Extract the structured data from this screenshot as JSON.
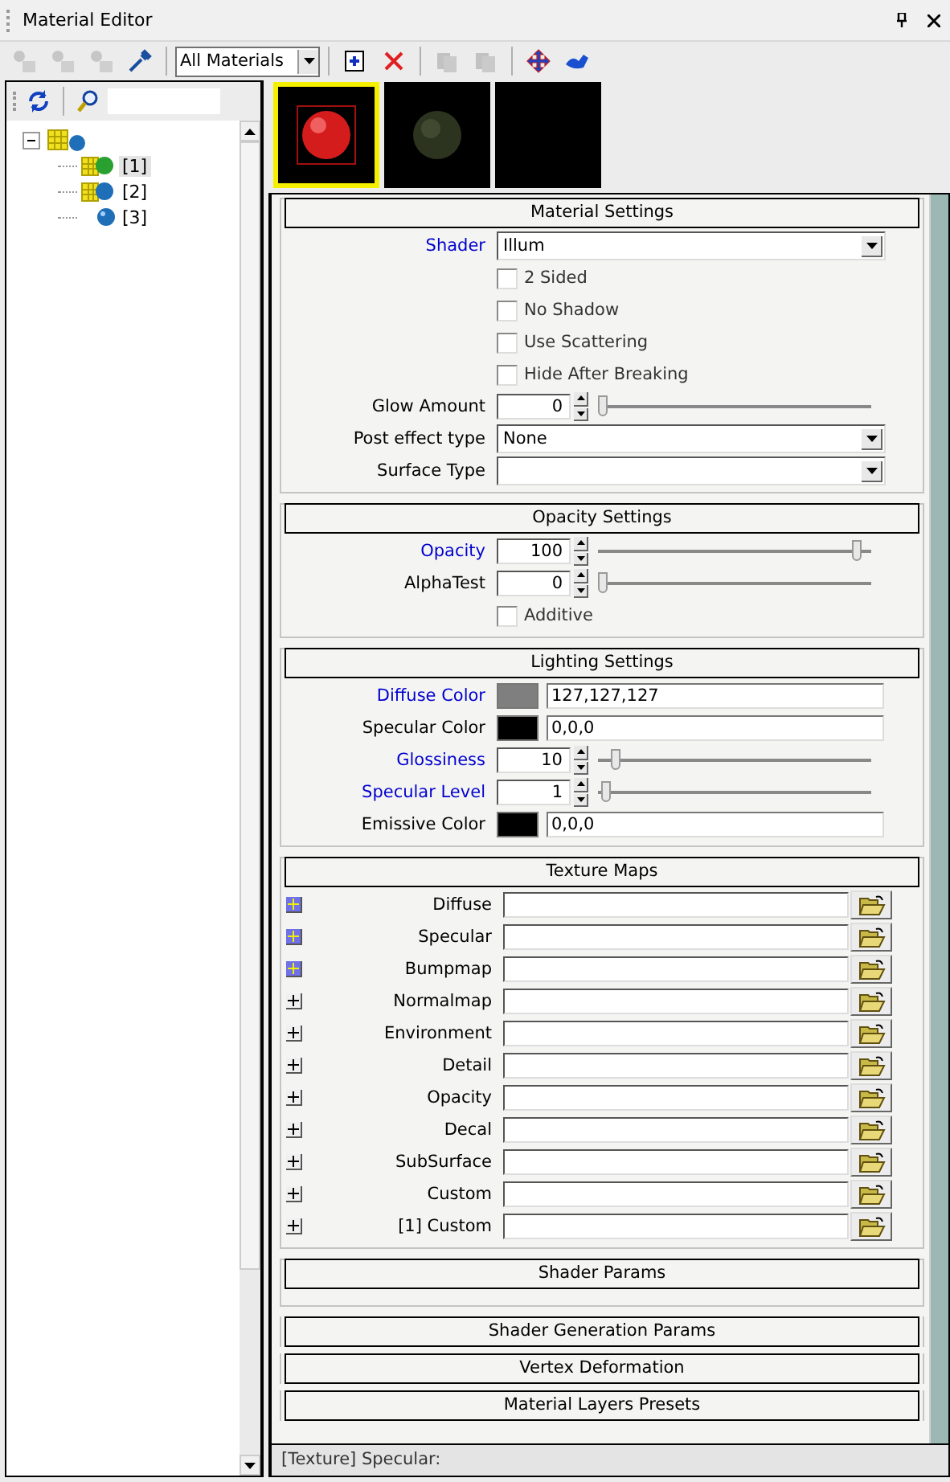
{
  "window": {
    "title": "Material Editor"
  },
  "toolbar": {
    "left_buttons": [
      {
        "kind": "get",
        "disabled": true
      },
      {
        "kind": "put",
        "disabled": true
      },
      {
        "kind": "assign",
        "disabled": true
      },
      {
        "kind": "pick",
        "disabled": false
      }
    ],
    "filter": {
      "value": "All Materials"
    },
    "right_buttons": [
      {
        "kind": "new",
        "disabled": false
      },
      {
        "kind": "delete",
        "disabled": false
      },
      {
        "kind": "copy",
        "disabled": true
      },
      {
        "kind": "paste",
        "disabled": true
      },
      {
        "kind": "move",
        "disabled": false
      },
      {
        "kind": "reset",
        "disabled": false
      }
    ]
  },
  "tree": {
    "items": [
      {
        "expanded": true,
        "kind": "group",
        "children": [
          {
            "label": "[1]",
            "selected": true,
            "kind": "active"
          },
          {
            "label": "[2]",
            "selected": false,
            "kind": "material"
          },
          {
            "label": "[3]",
            "selected": false,
            "kind": "sub"
          }
        ]
      }
    ]
  },
  "previews": [
    {
      "kind": "red-sphere",
      "selected": true
    },
    {
      "kind": "dark-sphere",
      "selected": false
    },
    {
      "kind": "empty",
      "selected": false
    }
  ],
  "sections": [
    {
      "title": "Material Settings",
      "expanded": true,
      "rows": [
        {
          "kind": "dropdown",
          "label": "Shader",
          "highlighted": true,
          "value": "Illum"
        },
        {
          "kind": "checkbox",
          "label": "2 Sided",
          "checked": false
        },
        {
          "kind": "checkbox",
          "label": "No Shadow",
          "checked": false
        },
        {
          "kind": "checkbox",
          "label": "Use Scattering",
          "checked": false
        },
        {
          "kind": "checkbox",
          "label": "Hide After Breaking",
          "checked": false
        },
        {
          "kind": "spinner",
          "label": "Glow Amount",
          "highlighted": false,
          "value": "0",
          "level": 0
        },
        {
          "kind": "dropdown",
          "label": "Post effect type",
          "highlighted": false,
          "value": "None"
        },
        {
          "kind": "dropdown",
          "label": "Surface Type",
          "highlighted": false,
          "value": ""
        }
      ]
    },
    {
      "title": "Opacity Settings",
      "expanded": true,
      "rows": [
        {
          "kind": "spinner",
          "label": "Opacity",
          "highlighted": true,
          "value": "100",
          "level": 1
        },
        {
          "kind": "spinner",
          "label": "AlphaTest",
          "highlighted": false,
          "value": "0",
          "level": 0
        },
        {
          "kind": "checkbox",
          "label": "Additive",
          "checked": false
        }
      ]
    },
    {
      "title": "Lighting Settings",
      "expanded": true,
      "rows": [
        {
          "kind": "color",
          "label": "Diffuse Color",
          "highlighted": true,
          "color": "#7f7f7f",
          "value": "127,127,127"
        },
        {
          "kind": "color",
          "label": "Specular Color",
          "highlighted": false,
          "color": "#000000",
          "value": "0,0,0"
        },
        {
          "kind": "spinner",
          "label": "Glossiness",
          "highlighted": true,
          "value": "10",
          "level": 0.05
        },
        {
          "kind": "spinner",
          "label": "Specular Level",
          "highlighted": true,
          "value": "1",
          "level": 0.01
        },
        {
          "kind": "color",
          "label": "Emissive Color",
          "highlighted": false,
          "color": "#000000",
          "value": "0,0,0"
        }
      ]
    },
    {
      "title": "Texture Maps",
      "expanded": true,
      "rows": [
        {
          "kind": "texture",
          "label": "Diffuse",
          "highlighted": true
        },
        {
          "kind": "texture",
          "label": "Specular",
          "highlighted": true
        },
        {
          "kind": "texture",
          "label": "Bumpmap",
          "highlighted": true
        },
        {
          "kind": "texture",
          "label": "Normalmap",
          "highlighted": false
        },
        {
          "kind": "texture",
          "label": "Environment",
          "highlighted": false
        },
        {
          "kind": "texture",
          "label": "Detail",
          "highlighted": false
        },
        {
          "kind": "texture",
          "label": "Opacity",
          "highlighted": false
        },
        {
          "kind": "texture",
          "label": "Decal",
          "highlighted": false
        },
        {
          "kind": "texture",
          "label": "SubSurface",
          "highlighted": false
        },
        {
          "kind": "texture",
          "label": "Custom",
          "highlighted": false
        },
        {
          "kind": "texture",
          "label": "[1] Custom",
          "highlighted": false
        }
      ]
    },
    {
      "title": "Shader Params",
      "expanded": true
    },
    {
      "title": "Shader Generation Params",
      "expanded": false
    },
    {
      "title": "Vertex Deformation",
      "expanded": false
    },
    {
      "title": "Material Layers Presets",
      "expanded": false
    }
  ],
  "status_bar": {
    "text": "[Texture] Specular:"
  }
}
